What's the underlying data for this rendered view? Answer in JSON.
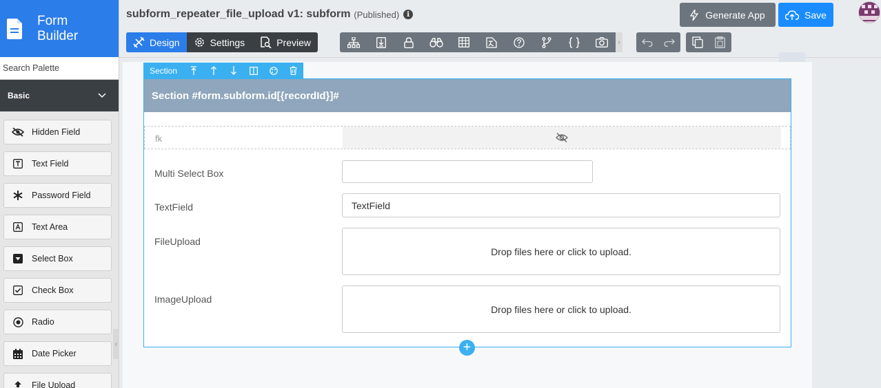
{
  "brand": {
    "line1": "Form",
    "line2": "Builder"
  },
  "palette": {
    "search_placeholder": "Search Palette",
    "group": "Basic",
    "items": [
      {
        "label": "Hidden Field",
        "icon": "eye-slash-icon"
      },
      {
        "label": "Text Field",
        "icon": "text-field-icon"
      },
      {
        "label": "Password Field",
        "icon": "asterisk-icon"
      },
      {
        "label": "Text Area",
        "icon": "text-area-icon"
      },
      {
        "label": "Select Box",
        "icon": "caret-square-down-icon"
      },
      {
        "label": "Check Box",
        "icon": "check-square-icon"
      },
      {
        "label": "Radio",
        "icon": "radio-dot-icon"
      },
      {
        "label": "Date Picker",
        "icon": "calendar-icon"
      },
      {
        "label": "File Upload",
        "icon": "upload-icon"
      }
    ]
  },
  "header": {
    "title": "subform_repeater_file_upload v1: subform",
    "status": "(Published)",
    "generate_label": "Generate App",
    "save_label": "Save",
    "tabs": [
      {
        "label": "Design",
        "icon": "design-icon",
        "active": true
      },
      {
        "label": "Settings",
        "icon": "gear-icon",
        "active": false
      },
      {
        "label": "Preview",
        "icon": "preview-icon",
        "active": false
      }
    ]
  },
  "section": {
    "toolbar_label": "Section",
    "heading": "Section #form.subform.id[{recordId}]#"
  },
  "fields": {
    "hidden_label": "fk",
    "multiselect_label": "Multi Select Box",
    "textfield_label": "TextField",
    "textfield_value": "TextField",
    "fileupload_label": "FileUpload",
    "fileupload_drop": "Drop files here or click to upload.",
    "imageupload_label": "ImageUpload",
    "imageupload_drop": "Drop files here or click to upload."
  },
  "colors": {
    "accent": "#2b7de9",
    "selection": "#3ab0f0",
    "dark": "#3a3f44",
    "section_head": "#8fa6bc"
  }
}
